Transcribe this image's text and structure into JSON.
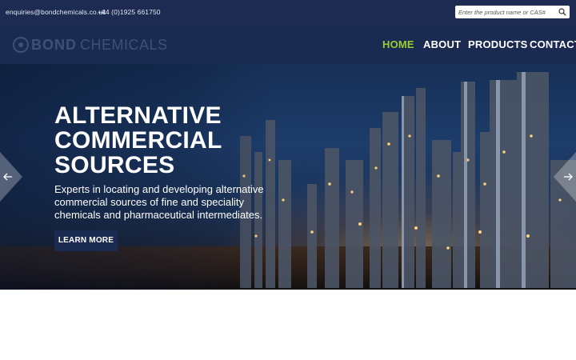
{
  "topbar": {
    "email": "enquiries@bondchemicals.co.uk",
    "phone": "+44 (0)1925 661750",
    "search_placeholder": "Enter the product name or CAS#",
    "search_icon": "search-icon"
  },
  "logo": {
    "name": "BOND",
    "sub": "CHEMICALS"
  },
  "nav": {
    "home": "HOME",
    "about": "ABOUT",
    "products": "PRODUCTS",
    "contact": "CONTACT",
    "active": "HOME",
    "active_color": "#9acd32"
  },
  "hero": {
    "title_lines": [
      "ALTERNATIVE",
      "COMMERCIAL",
      "SOURCES"
    ],
    "description_lines": [
      "Experts in locating and developing alternative",
      "commercial sources of fine and speciality",
      "chemicals and pharmaceutical intermediates."
    ],
    "button_label": "LEARN MORE",
    "prev_icon": "arrow-left-icon",
    "next_icon": "arrow-right-icon"
  },
  "colors": {
    "topbar_bg": "#1d2b52",
    "nav_bg": "#1a2a50",
    "button_bg": "#1a2a50"
  }
}
